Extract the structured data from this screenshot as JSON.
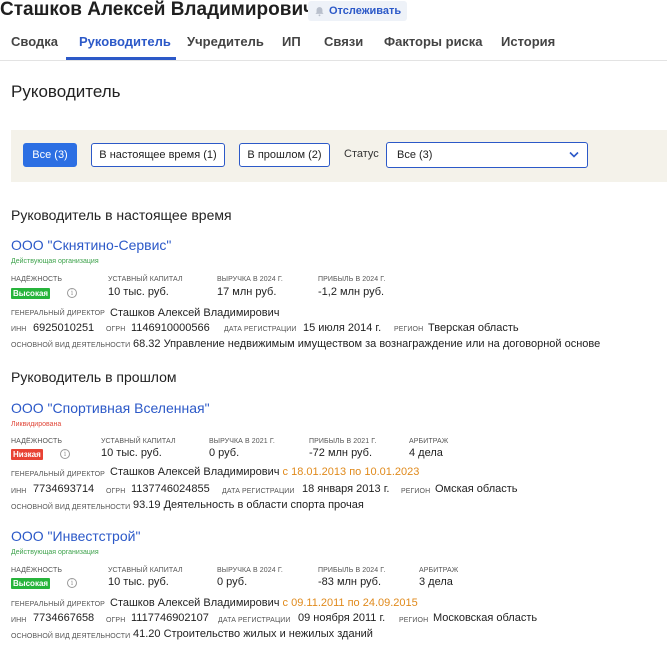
{
  "header": {
    "person_name": "Сташков Алексей Владимирович",
    "track_label": "Отслеживать"
  },
  "tabs": [
    "Сводка",
    "Руководитель",
    "Учредитель",
    "ИП",
    "Связи",
    "Факторы риска",
    "История"
  ],
  "section_title": "Руководитель",
  "filters": {
    "all_label": "Все (3)",
    "current_label": "В настоящее время (1)",
    "past_label": "В прошлом (2)",
    "status_label": "Статус",
    "status_value": "Все (3)"
  },
  "current_heading": "Руководитель в настоящее время",
  "past_heading": "Руководитель в прошлом",
  "labels": {
    "reliability": "Надёжность",
    "capital": "Уставный капитал",
    "director": "Генеральный директор",
    "inn": "ИНН",
    "ogrn": "ОГРН",
    "reg_date": "Дата регистрации",
    "region": "Регион",
    "activity": "Основной вид деятельности",
    "arbitration": "Арбитраж"
  },
  "orgs": [
    {
      "name": "ООО \"Скнятино-Сервис\"",
      "status": "Действующая организация",
      "reliability": "Высокая",
      "capital": "10 тыс. руб.",
      "revenue_label": "Выручка в 2024 г.",
      "revenue": "17 млн руб.",
      "profit_label": "Прибыль в 2024 г.",
      "profit": "-1,2 млн руб.",
      "director": "Сташков Алексей Владимирович",
      "period": "",
      "inn": "6925010251",
      "ogrn": "1146910000566",
      "reg_date": "15 июля 2014 г.",
      "region": "Тверская область",
      "activity": "68.32 Управление недвижимым имуществом за вознаграждение или на договорной основе",
      "arbitration": ""
    },
    {
      "name": "ООО \"Спортивная Вселенная\"",
      "status": "Ликвидирована",
      "reliability": "Низкая",
      "capital": "10 тыс. руб.",
      "revenue_label": "Выручка в 2021 г.",
      "revenue": "0 руб.",
      "profit_label": "Прибыль в 2021 г.",
      "profit": "-72 млн руб.",
      "director": "Сташков Алексей Владимирович",
      "period": "с 18.01.2013 по 10.01.2023",
      "inn": "7734693714",
      "ogrn": "1137746024855",
      "reg_date": "18 января 2013 г.",
      "region": "Омская область",
      "activity": "93.19 Деятельность в области спорта прочая",
      "arbitration": "4 дела"
    },
    {
      "name": "ООО \"Инвестстрой\"",
      "status": "Действующая организация",
      "reliability": "Высокая",
      "capital": "10 тыс. руб.",
      "revenue_label": "Выручка в 2024 г.",
      "revenue": "0 руб.",
      "profit_label": "Прибыль в 2024 г.",
      "profit": "-83 млн руб.",
      "director": "Сташков Алексей Владимирович",
      "period": "с 09.11.2011 по 24.09.2015",
      "inn": "7734667658",
      "ogrn": "1117746902107",
      "reg_date": "09 ноября 2011 г.",
      "region": "Московская область",
      "activity": "41.20 Строительство жилых и нежилых зданий",
      "arbitration": "3 дела"
    }
  ],
  "colors": {
    "accent": "#2c59c8",
    "high": "#27b43b",
    "low": "#e84234",
    "period": "#e08a1c"
  },
  "icons": {
    "track": "bell-icon",
    "select": "chevron-down-icon",
    "info": "info-icon"
  }
}
